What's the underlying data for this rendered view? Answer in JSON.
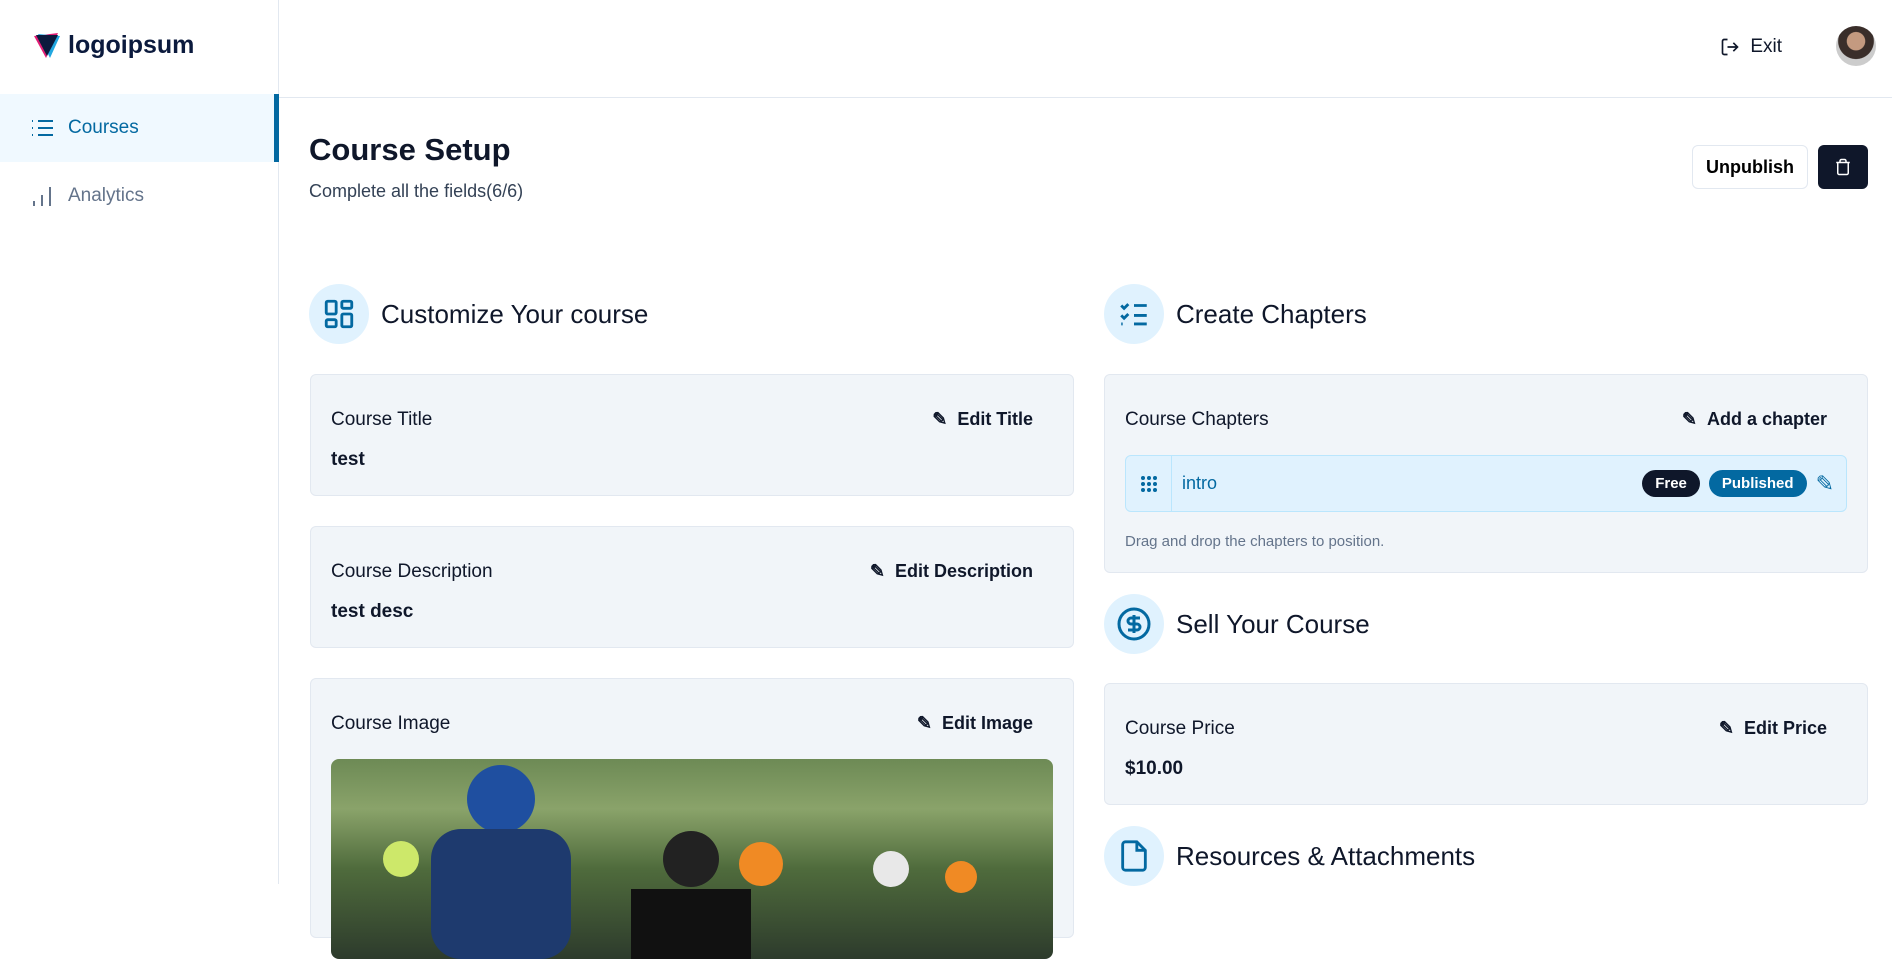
{
  "logo": {
    "text": "logoipsum"
  },
  "sidebar": {
    "items": [
      {
        "label": "Courses",
        "icon": "list-icon",
        "active": true
      },
      {
        "label": "Analytics",
        "icon": "bar-chart-icon",
        "active": false
      }
    ]
  },
  "header": {
    "exit_label": "Exit"
  },
  "page": {
    "title": "Course Setup",
    "subtitle": "Complete all the fields(6/6)",
    "unpublish_label": "Unpublish"
  },
  "customize": {
    "heading": "Customize Your course",
    "title": {
      "label": "Course Title",
      "value": "test",
      "edit": "Edit Title"
    },
    "description": {
      "label": "Course Description",
      "value": "test desc",
      "edit": "Edit Description"
    },
    "image": {
      "label": "Course Image",
      "edit": "Edit Image"
    }
  },
  "chapters": {
    "heading": "Create Chapters",
    "label": "Course Chapters",
    "add": "Add a chapter",
    "items": [
      {
        "title": "intro",
        "badges": [
          "Free",
          "Published"
        ]
      }
    ],
    "hint": "Drag and drop the chapters to position."
  },
  "sell": {
    "heading": "Sell Your Course",
    "label": "Course Price",
    "value": "$10.00",
    "edit": "Edit Price"
  },
  "resources": {
    "heading": "Resources & Attachments"
  },
  "colors": {
    "accent": "#0369a1",
    "dark": "#0f172a",
    "card": "#f1f5f9",
    "chip_bg": "#e0f2fe"
  }
}
